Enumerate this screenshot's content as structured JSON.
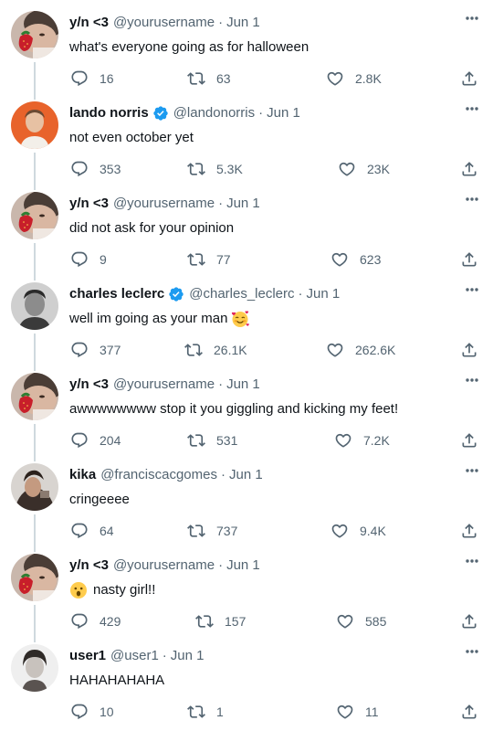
{
  "tweets": [
    {
      "user_name": "y/n <3",
      "handle": "@yourusername",
      "separator": "·",
      "date": "Jun 1",
      "verified": false,
      "text": "what's everyone going as for halloween",
      "replies": "16",
      "retweets": "63",
      "likes": "2.8K",
      "avatar_icon": "strawberry-avatar-icon"
    },
    {
      "user_name": "lando norris",
      "handle": "@landonorris",
      "separator": "·",
      "date": "Jun 1",
      "verified": true,
      "text": "not even october yet",
      "replies": "353",
      "retweets": "5.3K",
      "likes": "23K",
      "avatar_icon": "orange-portrait-avatar-icon"
    },
    {
      "user_name": "y/n <3",
      "handle": "@yourusername",
      "separator": "·",
      "date": "Jun 1",
      "verified": false,
      "text": "did not ask for your opinion",
      "replies": "9",
      "retweets": "77",
      "likes": "623",
      "avatar_icon": "strawberry-avatar-icon"
    },
    {
      "user_name": "charles leclerc",
      "handle": "@charles_leclerc",
      "separator": "·",
      "date": "Jun 1",
      "verified": true,
      "text": "well im going as your man",
      "trailing_emoji": "smiling-face-with-hearts-emoji",
      "replies": "377",
      "retweets": "26.1K",
      "likes": "262.6K",
      "avatar_icon": "monochrome-portrait-avatar-icon"
    },
    {
      "user_name": "y/n <3",
      "handle": "@yourusername",
      "separator": "·",
      "date": "Jun 1",
      "verified": false,
      "text": "awwwwwwww stop it you giggling and kicking my feet!",
      "replies": "204",
      "retweets": "531",
      "likes": "7.2K",
      "avatar_icon": "strawberry-avatar-icon"
    },
    {
      "user_name": "kika",
      "handle": "@franciscacgomes",
      "separator": "·",
      "date": "Jun 1",
      "verified": false,
      "text": "cringeeee",
      "replies": "64",
      "retweets": "737",
      "likes": "9.4K",
      "avatar_icon": "dark-portrait-avatar-icon"
    },
    {
      "user_name": "y/n <3",
      "handle": "@yourusername",
      "separator": "·",
      "date": "Jun 1",
      "verified": false,
      "text": "nasty girl!!",
      "leading_emoji": "face-with-open-mouth-emoji",
      "replies": "429",
      "retweets": "157",
      "likes": "585",
      "avatar_icon": "strawberry-avatar-icon"
    },
    {
      "user_name": "user1",
      "handle": "@user1",
      "separator": "·",
      "date": "Jun 1",
      "verified": false,
      "text": "HAHAHAHAHA",
      "replies": "10",
      "retweets": "1",
      "likes": "11",
      "avatar_icon": "light-portrait-avatar-icon"
    }
  ],
  "colors": {
    "text": "#0f1419",
    "muted": "#536471",
    "verified": "#1d9bf0",
    "thread_line": "#cfd9de"
  },
  "icons": {
    "reply": "reply-icon",
    "retweet": "retweet-icon",
    "like": "heart-icon",
    "share": "share-icon",
    "more": "more-icon",
    "verified": "verified-badge-icon"
  }
}
